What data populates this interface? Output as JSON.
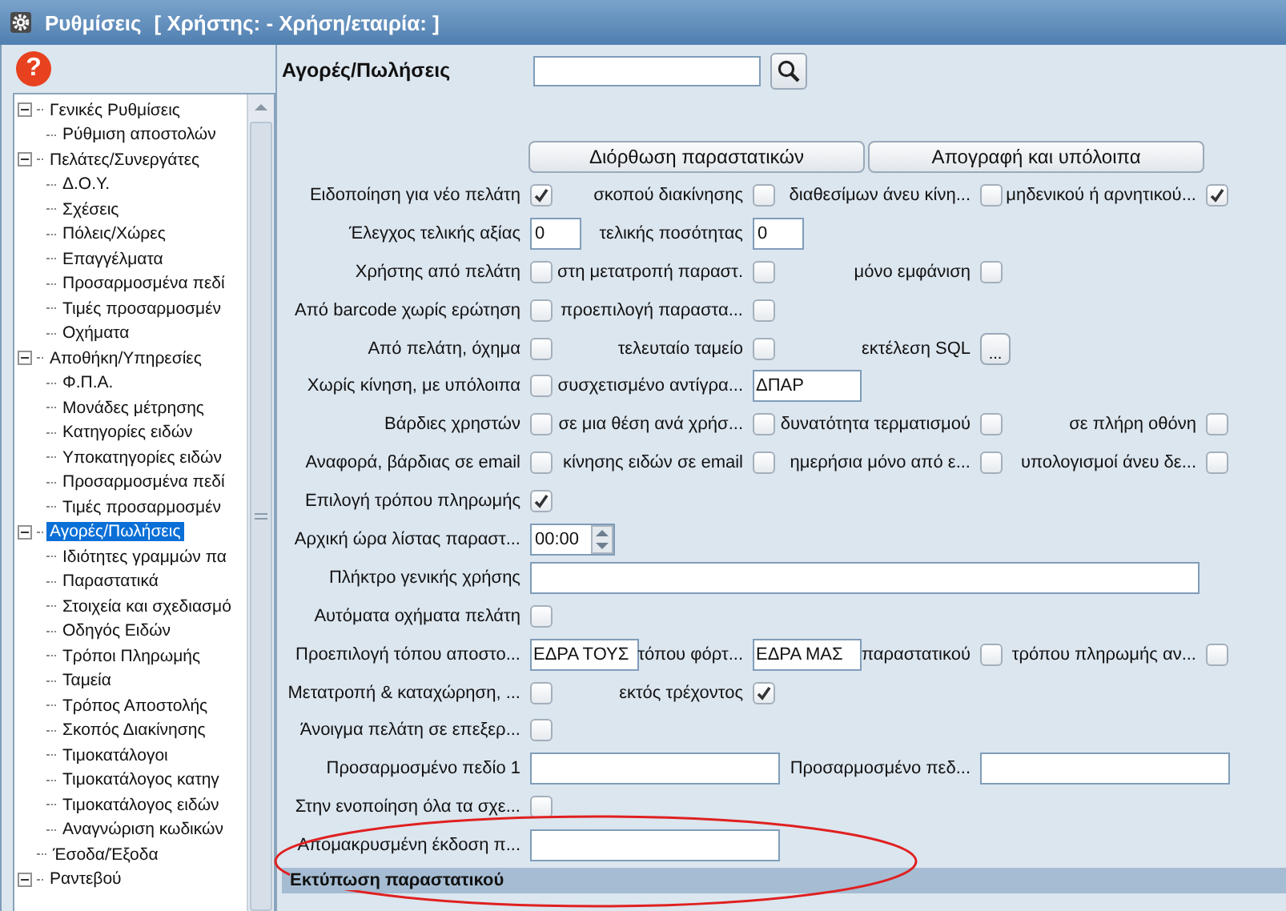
{
  "window": {
    "title": "Ρυθμίσεις",
    "subtitle": "[ Χρήστης: - Χρήση/εταιρία: ]"
  },
  "help_icon": "?",
  "tree": [
    {
      "label": "Γενικές Ρυθμίσεις",
      "selected": false,
      "expanded": true,
      "children": [
        {
          "label": "Ρύθμιση αποστολών",
          "selected": false
        }
      ]
    },
    {
      "label": "Πελάτες/Συνεργάτες",
      "selected": false,
      "expanded": true,
      "children": [
        {
          "label": "Δ.Ο.Υ.",
          "selected": false
        },
        {
          "label": "Σχέσεις",
          "selected": false
        },
        {
          "label": "Πόλεις/Χώρες",
          "selected": false
        },
        {
          "label": "Επαγγέλματα",
          "selected": false
        },
        {
          "label": "Προσαρμοσμένα πεδί",
          "selected": false
        },
        {
          "label": "Τιμές προσαρμοσμέν",
          "selected": false
        },
        {
          "label": "Οχήματα",
          "selected": false
        }
      ]
    },
    {
      "label": "Αποθήκη/Υπηρεσίες",
      "selected": false,
      "expanded": true,
      "children": [
        {
          "label": "Φ.Π.Α.",
          "selected": false
        },
        {
          "label": "Μονάδες μέτρησης",
          "selected": false
        },
        {
          "label": "Κατηγορίες ειδών",
          "selected": false
        },
        {
          "label": "Υποκατηγορίες ειδών",
          "selected": false
        },
        {
          "label": "Προσαρμοσμένα πεδί",
          "selected": false
        },
        {
          "label": "Τιμές προσαρμοσμέν",
          "selected": false
        }
      ]
    },
    {
      "label": "Αγορές/Πωλήσεις",
      "selected": true,
      "expanded": true,
      "children": [
        {
          "label": "Ιδιότητες γραμμών πα",
          "selected": false
        },
        {
          "label": "Παραστατικά",
          "selected": false
        },
        {
          "label": "Στοιχεία και σχεδιασμό",
          "selected": false
        },
        {
          "label": "Οδηγός Ειδών",
          "selected": false
        },
        {
          "label": "Τρόποι Πληρωμής",
          "selected": false
        },
        {
          "label": "Ταμεία",
          "selected": false
        },
        {
          "label": "Τρόπος Αποστολής",
          "selected": false
        },
        {
          "label": "Σκοπός Διακίνησης",
          "selected": false
        },
        {
          "label": "Τιμοκατάλογοι",
          "selected": false
        },
        {
          "label": "Τιμοκατάλογος κατηγ",
          "selected": false
        },
        {
          "label": "Τιμοκατάλογος ειδών",
          "selected": false
        },
        {
          "label": "Αναγνώριση κωδικών",
          "selected": false
        }
      ]
    },
    {
      "label": "Έσοδα/Έξοδα",
      "selected": false
    },
    {
      "label": "Ραντεβού",
      "selected": false,
      "expanded": true
    }
  ],
  "header": {
    "title": "Αγορές/Πωλήσεις"
  },
  "buttons": [
    "Διόρθωση παραστατικών",
    "Απογραφή και υπόλοιπα"
  ],
  "rows": [
    {
      "items": [
        {
          "label": "Ειδοποίηση για νέο πελάτη",
          "kind": "checkbox",
          "checked": true
        },
        {
          "label": "σκοπού διακίνησης",
          "kind": "checkbox",
          "checked": false
        },
        {
          "label": "διαθεσίμων άνευ κίνη...",
          "kind": "checkbox",
          "checked": false
        },
        {
          "label": "μηδενικού ή αρνητικού...",
          "kind": "checkbox",
          "checked": true
        }
      ]
    },
    {
      "items": [
        {
          "label": "Έλεγχος τελικής αξίας",
          "kind": "number-field",
          "value": "0"
        },
        {
          "label": "τελικής ποσότητας",
          "kind": "number-field",
          "value": "0"
        }
      ]
    },
    {
      "items": [
        {
          "label": "Χρήστης από πελάτη",
          "kind": "checkbox",
          "checked": false
        },
        {
          "label": "στη μετατροπή παραστ.",
          "kind": "checkbox",
          "checked": false
        },
        {
          "label": "μόνο εμφάνιση",
          "kind": "checkbox",
          "checked": false
        }
      ]
    },
    {
      "items": [
        {
          "label": "Από barcode χωρίς ερώτηση",
          "kind": "checkbox",
          "checked": false
        },
        {
          "label": "προεπιλογή παραστα...",
          "kind": "checkbox",
          "checked": false
        }
      ]
    },
    {
      "items": [
        {
          "label": "Από πελάτη, όχημα",
          "kind": "checkbox",
          "checked": false
        },
        {
          "label": "τελευταίο ταμείο",
          "kind": "checkbox",
          "checked": false
        },
        {
          "label": "εκτέλεση SQL",
          "kind": "button",
          "value": "..."
        }
      ]
    },
    {
      "items": [
        {
          "label": "Χωρίς κίνηση, με υπόλοιπα",
          "kind": "checkbox",
          "checked": false
        },
        {
          "label": "συσχετισμένο αντίγρα...",
          "kind": "short-field",
          "value": "ΔΠΑΡ"
        }
      ]
    },
    {
      "items": [
        {
          "label": "Βάρδιες χρηστών",
          "kind": "checkbox",
          "checked": false
        },
        {
          "label": "σε μια θέση ανά χρήσ...",
          "kind": "checkbox",
          "checked": false
        },
        {
          "label": "δυνατότητα τερματισμού",
          "kind": "checkbox",
          "checked": false
        },
        {
          "label": "σε πλήρη οθόνη",
          "kind": "checkbox",
          "checked": false
        }
      ]
    },
    {
      "items": [
        {
          "label": "Αναφορά, βάρδιας σε email",
          "kind": "checkbox",
          "checked": false
        },
        {
          "label": "κίνησης ειδών σε email",
          "kind": "checkbox",
          "checked": false
        },
        {
          "label": "ημερήσια μόνο από ε...",
          "kind": "checkbox",
          "checked": false
        },
        {
          "label": "υπολογισμοί άνευ δε...",
          "kind": "checkbox",
          "checked": false
        }
      ]
    },
    {
      "items": [
        {
          "label": "Επιλογή τρόπου πληρωμής",
          "kind": "checkbox",
          "checked": true
        }
      ]
    },
    {
      "items": [
        {
          "label": "Αρχική ώρα λίστας παραστ...",
          "kind": "spinner",
          "value": "00:00"
        }
      ]
    },
    {
      "items": [
        {
          "label": "Πλήκτρο γενικής χρήσης",
          "kind": "wide-field"
        }
      ]
    },
    {
      "items": [
        {
          "label": "Αυτόματα οχήματα πελάτη",
          "kind": "checkbox",
          "checked": false
        }
      ]
    },
    {
      "items": [
        {
          "label": "Προεπιλογή τόπου αποστο...",
          "kind": "short-field",
          "value": "ΕΔΡΑ ΤΟΥΣ"
        },
        {
          "label": "τόπου φόρτ...",
          "kind": "short-field",
          "value": "ΕΔΡΑ ΜΑΣ"
        },
        {
          "label": "παραστατικού",
          "kind": "checkbox",
          "checked": false
        },
        {
          "label": "τρόπου πληρωμής αν...",
          "kind": "checkbox",
          "checked": false
        }
      ]
    },
    {
      "items": [
        {
          "label": "Μετατροπή & καταχώρηση, ...",
          "kind": "checkbox",
          "checked": false
        },
        {
          "label": "εκτός τρέχοντος",
          "kind": "checkbox",
          "checked": true
        }
      ]
    },
    {
      "items": [
        {
          "label": "Άνοιγμα πελάτη σε επεξερ...",
          "kind": "checkbox",
          "checked": false
        }
      ]
    },
    {
      "items": [
        {
          "label": "Προσαρμοσμένο πεδίο 1",
          "kind": "field"
        },
        {
          "label": "Προσαρμοσμένο πεδ...",
          "kind": "field"
        }
      ]
    },
    {
      "items": [
        {
          "label": "Στην ενοποίηση όλα τα σχε...",
          "kind": "checkbox",
          "checked": false
        }
      ]
    },
    {
      "items": [
        {
          "label": "Απομακρυσμένη έκδοση π...",
          "kind": "field"
        }
      ]
    }
  ],
  "section": {
    "title": "Εκτύπωση παραστατικού"
  }
}
